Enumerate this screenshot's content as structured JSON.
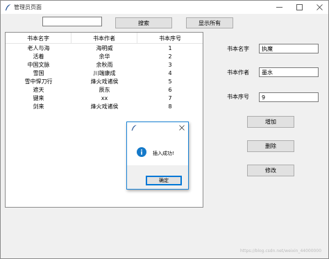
{
  "window": {
    "title": "管理员页面",
    "icons": {
      "app": "feather-icon",
      "minimize": "minimize-icon",
      "maximize": "maximize-icon",
      "close": "close-icon"
    }
  },
  "toolbar": {
    "search_value": "",
    "search_button": "搜索",
    "show_all_button": "显示所有"
  },
  "table": {
    "columns": [
      "书本名字",
      "书本作者",
      "书本序号"
    ],
    "rows": [
      [
        "老人与海",
        "海明威",
        "1"
      ],
      [
        "活着",
        "余华",
        "2"
      ],
      [
        "中国文脉",
        "余秋雨",
        "3"
      ],
      [
        "雪国",
        "川端康成",
        "4"
      ],
      [
        "雪中悍刀行",
        "烽火戏诸侯",
        "5"
      ],
      [
        "遮天",
        "辰东",
        "6"
      ],
      [
        "键来",
        "xx",
        "7"
      ],
      [
        "剑来",
        "烽火戏诸侯",
        "8"
      ]
    ]
  },
  "form": {
    "name_label": "书本名字",
    "name_value": "执魔",
    "author_label": "书本作者",
    "author_value": "墨水",
    "number_label": "书本序号",
    "number_value": "9",
    "add_button": "增加",
    "delete_button": "删除",
    "edit_button": "修改"
  },
  "dialog": {
    "title": "",
    "message": "插入成功!",
    "ok_button": "确定",
    "icons": {
      "app": "feather-icon",
      "close": "close-icon",
      "info": "info-icon"
    }
  },
  "watermark": "https://blog.csdn.net/weixin_44000000",
  "colors": {
    "dialog_border": "#1883d7",
    "info_icon": "#1479c9",
    "ok_border": "#0078d7"
  }
}
